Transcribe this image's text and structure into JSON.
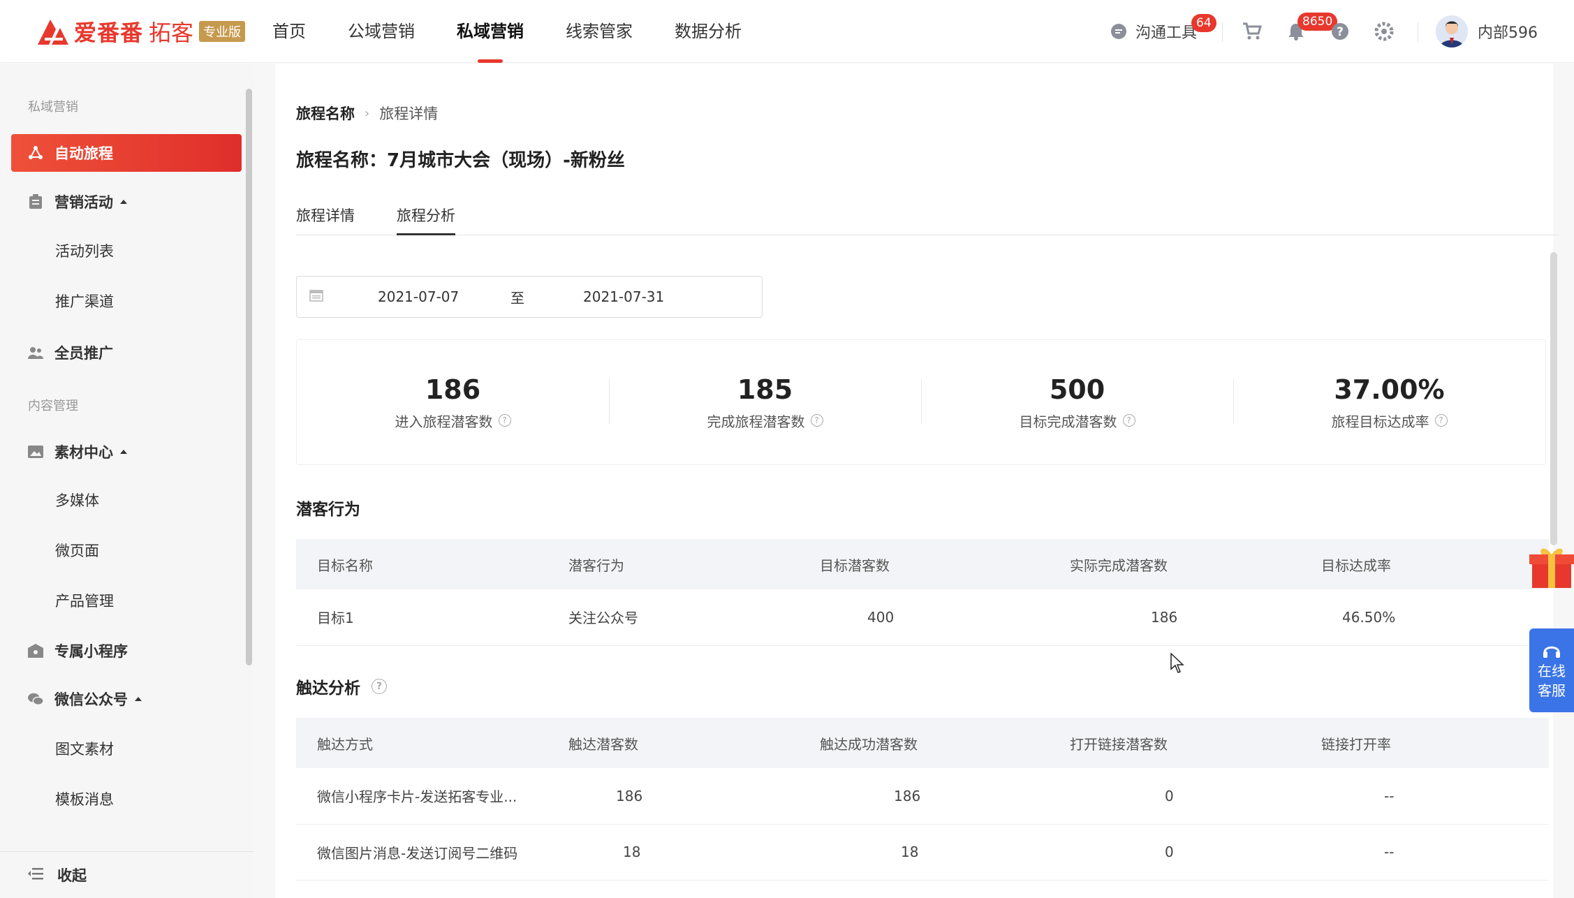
{
  "brand": {
    "name": "爱番番",
    "product": "拓客",
    "edition": "专业版",
    "color": "#e8382d"
  },
  "topnav": [
    {
      "label": "首页",
      "active": false
    },
    {
      "label": "公域营销",
      "active": false
    },
    {
      "label": "私域营销",
      "active": true
    },
    {
      "label": "线索管家",
      "active": false
    },
    {
      "label": "数据分析",
      "active": false
    }
  ],
  "topright": {
    "chat_tool_label": "沟通工具",
    "chat_badge": "64",
    "bell_badge": "8650",
    "user_name": "内部596"
  },
  "sidebar": {
    "section1": "私域营销",
    "auto_journey": "自动旅程",
    "marketing_activity": "营销活动",
    "activity_list": "活动列表",
    "promo_channel": "推广渠道",
    "all_staff": "全员推广",
    "section2": "内容管理",
    "material_center": "素材中心",
    "multimedia": "多媒体",
    "micro_page": "微页面",
    "product_mgmt": "产品管理",
    "mini_program": "专属小程序",
    "wechat_official": "微信公众号",
    "image_text": "图文素材",
    "template_msg": "模板消息",
    "collapse": "收起"
  },
  "breadcrumb": {
    "parent": "旅程名称",
    "current": "旅程详情"
  },
  "page_title": "旅程名称：7月城市大会（现场）-新粉丝",
  "tabs": [
    {
      "label": "旅程详情",
      "active": false
    },
    {
      "label": "旅程分析",
      "active": true
    }
  ],
  "date_range": {
    "start": "2021-07-07",
    "separator": "至",
    "end": "2021-07-31"
  },
  "stats": [
    {
      "value": "186",
      "label": "进入旅程潜客数"
    },
    {
      "value": "185",
      "label": "完成旅程潜客数"
    },
    {
      "value": "500",
      "label": "目标完成潜客数"
    },
    {
      "value": "37.00%",
      "label": "旅程目标达成率"
    }
  ],
  "behavior": {
    "title": "潜客行为",
    "columns": [
      "目标名称",
      "潜客行为",
      "目标潜客数",
      "实际完成潜客数",
      "目标达成率"
    ],
    "rows": [
      [
        "目标1",
        "关注公众号",
        "400",
        "186",
        "46.50%"
      ]
    ]
  },
  "reach": {
    "title": "触达分析",
    "columns": [
      "触达方式",
      "触达潜客数",
      "触达成功潜客数",
      "打开链接潜客数",
      "链接打开率"
    ],
    "rows": [
      [
        "微信小程序卡片-发送拓客专业...",
        "186",
        "186",
        "0",
        "--"
      ],
      [
        "微信图片消息-发送订阅号二维码",
        "18",
        "18",
        "0",
        "--"
      ]
    ]
  },
  "service": {
    "line1": "在线",
    "line2": "客服"
  }
}
